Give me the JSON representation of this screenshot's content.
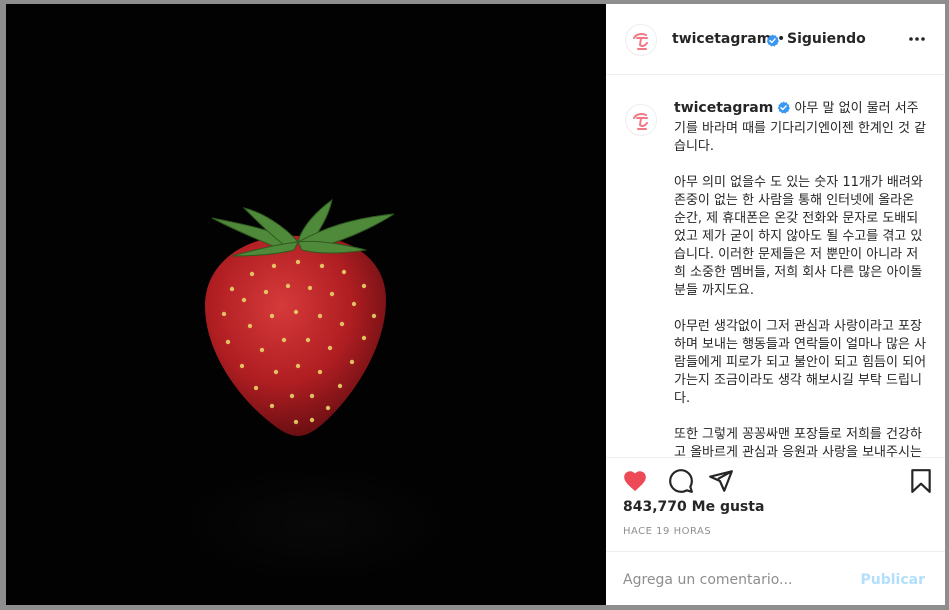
{
  "post": {
    "username": "twicetagram",
    "follow_separator": "•",
    "follow_status": "Siguiendo",
    "caption": {
      "paragraphs": [
        "아무 말 없이 물러 서주기를 바라며 때를 기다리기엔이젠 한계인 것 같습니다.",
        "아무 의미 없을수 도 있는 숫자 11개가 배려와 존중이 없는 한 사람을 통해 인터넷에 올라온 순간, 제 휴대폰은 온갖 전화와 문자로 도배되었고 제가 굳이 하지 않아도 될 수고를 겪고 있습니다. 이러한 문제들은 저 뿐만이 아니라 저희 소중한 멤버들, 저희 회사 다른 많은 아이돌분들 까지도요.",
        "아무런 생각없이 그저 관심과 사랑이라고 포장하며 보내는 행동들과 연락들이 얼마나 많은 사람들에게 피로가 되고 불안이 되고 힘듬이 되어가는지 조금이라도 생각 해보시길 부탁 드립니다.",
        "또한 그렇게 꽁꽁싸맨 포장들로 저희를 건강하고 올바르게 관심과 응원과 사랑을 보내주시는"
      ]
    },
    "likes_text": "843,770 Me gusta",
    "time_text": "HACE 19 HORAS",
    "comment_placeholder": "Agrega un comentario...",
    "publish_label": "Publicar",
    "liked": true
  },
  "icons": {
    "verified": "verified-badge-icon",
    "more": "more-options-icon",
    "like": "heart-icon",
    "comment": "comment-icon",
    "share": "share-icon",
    "save": "bookmark-icon"
  },
  "colors": {
    "like_red": "#ed4956",
    "verified_blue": "#3897f0",
    "publish_disabled": "#b2dffc",
    "twice_logo": "#f27a86"
  }
}
